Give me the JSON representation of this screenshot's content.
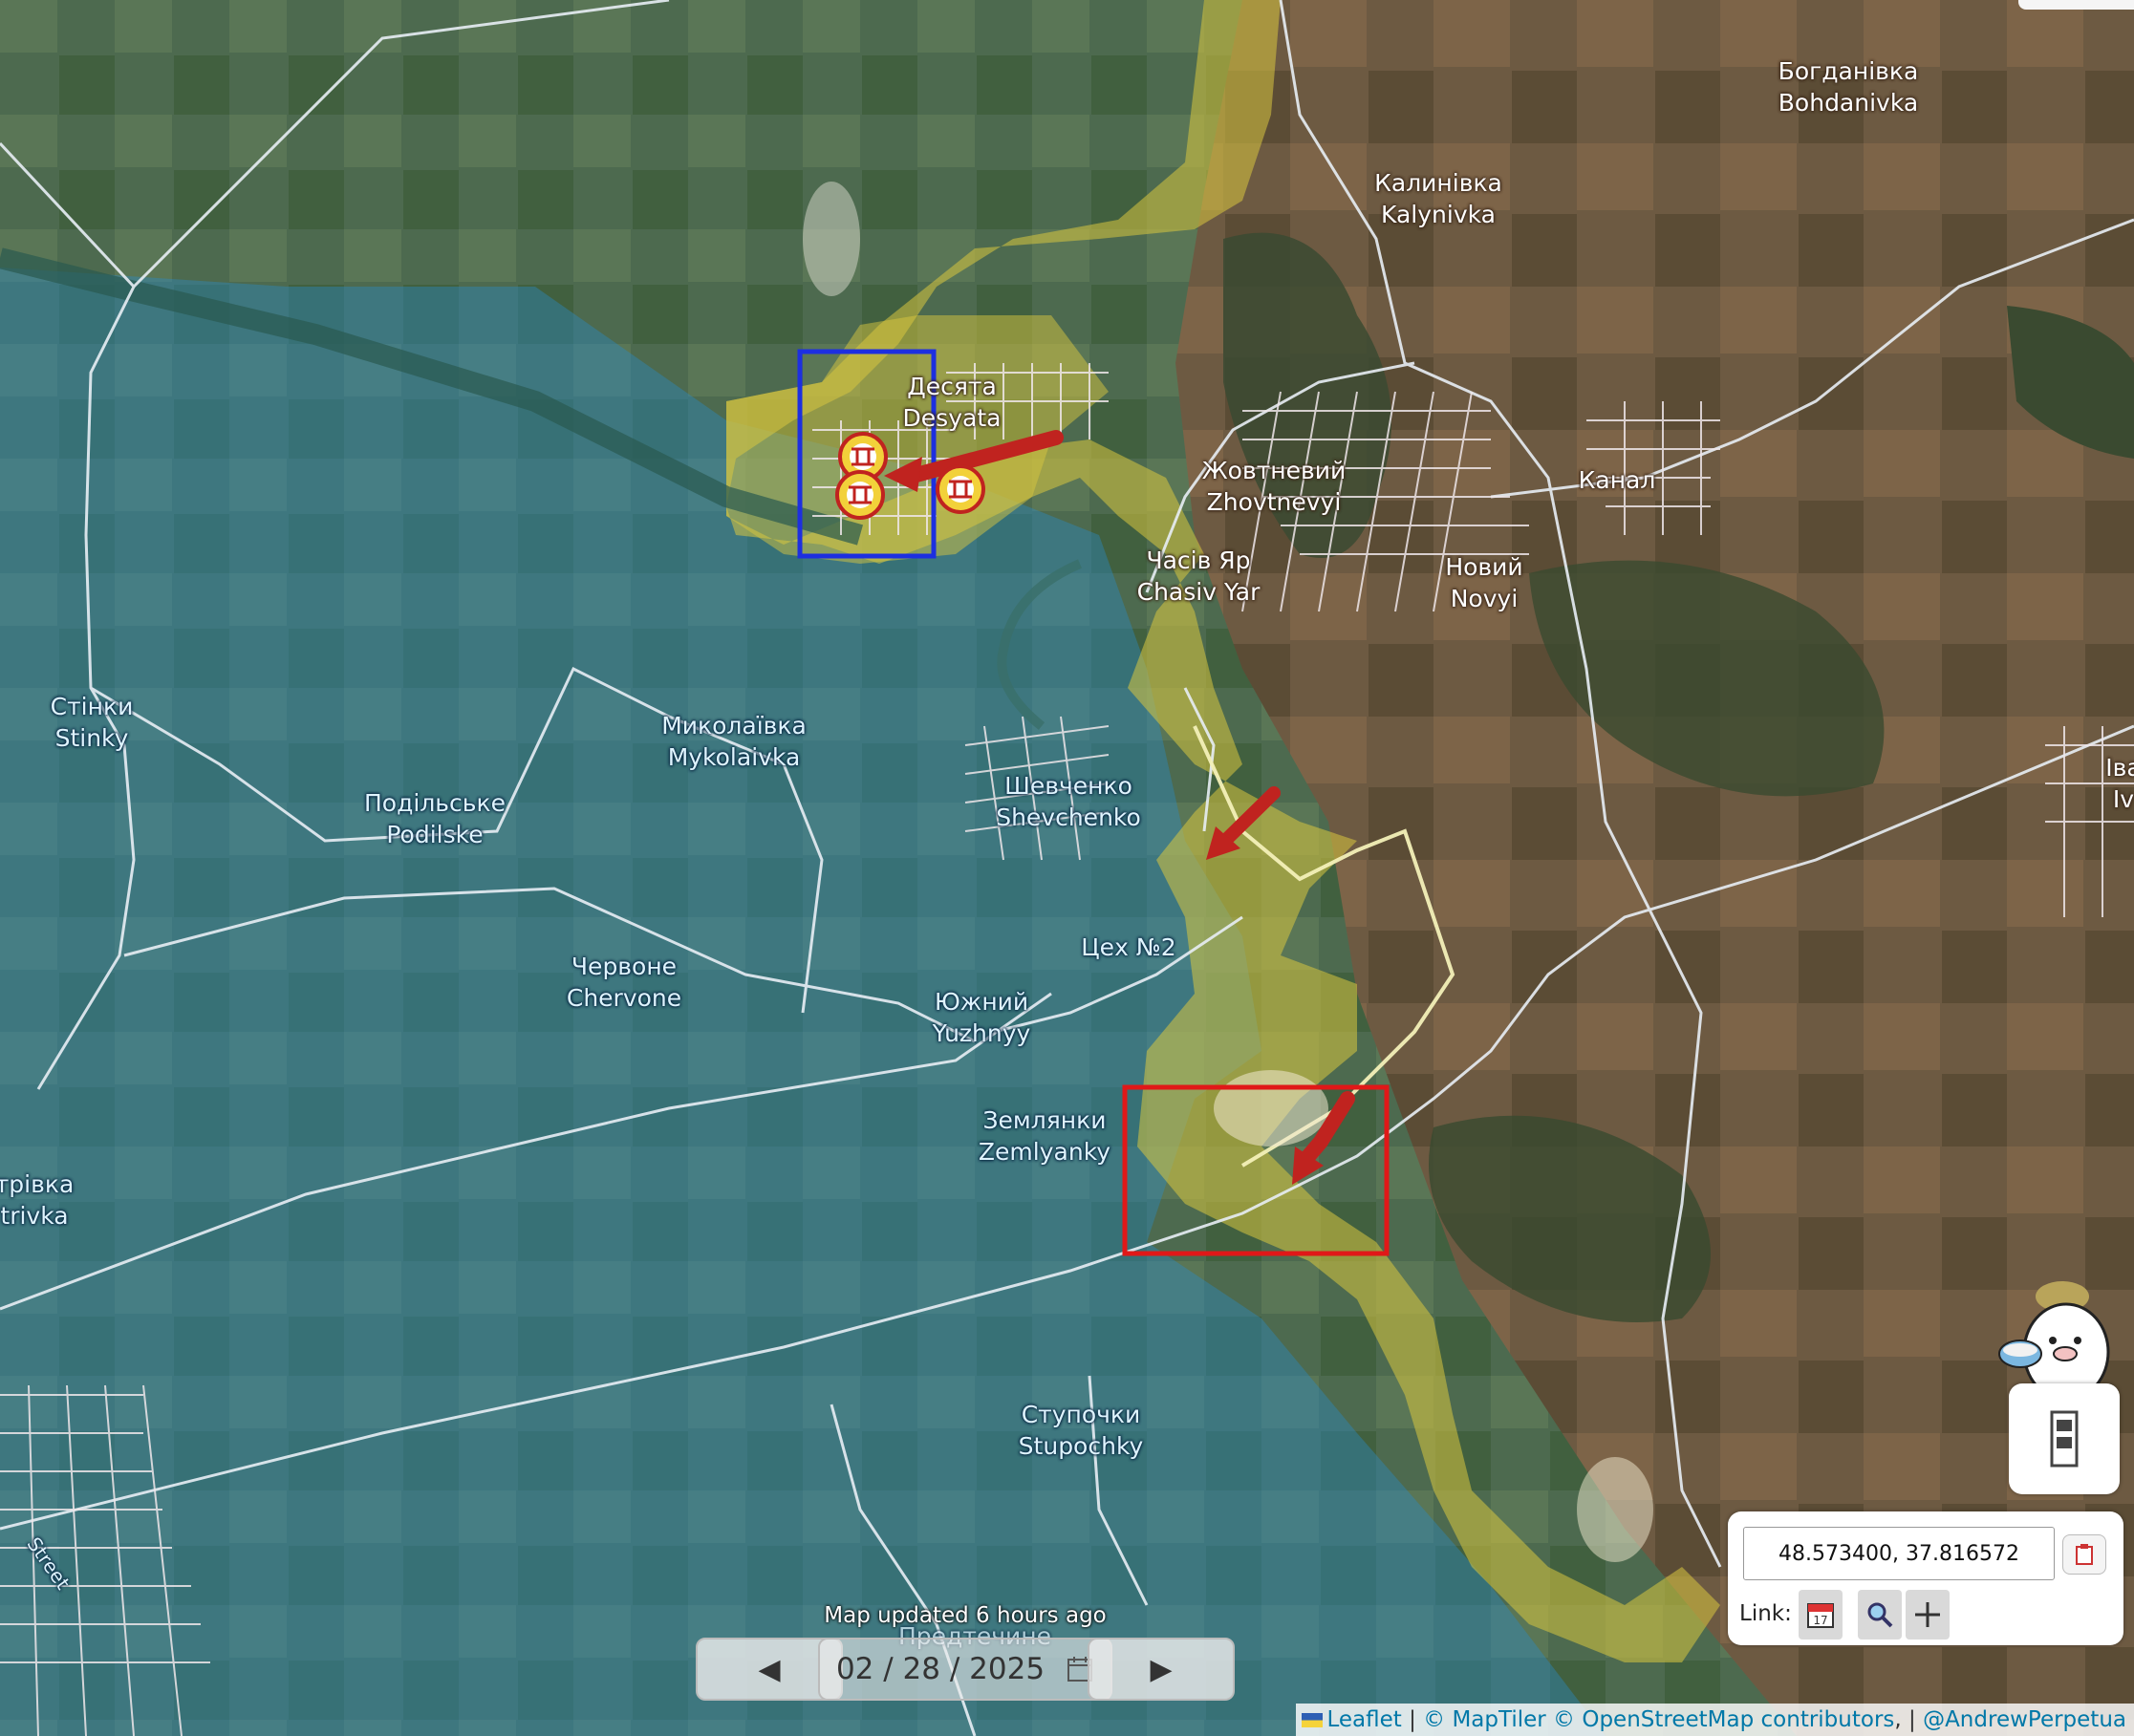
{
  "map": {
    "places": [
      {
        "id": "bohdanivka",
        "uk": "Богданівка",
        "en": "Bohdanivka",
        "style": "dark"
      },
      {
        "id": "kalynivka",
        "uk": "Калинівка",
        "en": "Kalynivka",
        "style": "dark"
      },
      {
        "id": "desyata",
        "uk": "Десята",
        "en": "Desyata",
        "style": "dark"
      },
      {
        "id": "zhovtnevyi",
        "uk": "Жовтневий",
        "en": "Zhovtnevyi",
        "style": "dark"
      },
      {
        "id": "kanal",
        "uk": "Канал",
        "en": "",
        "style": "dark"
      },
      {
        "id": "chasiv-yar",
        "uk": "Часів Яр",
        "en": "Chasiv Yar",
        "style": "dark"
      },
      {
        "id": "novyi",
        "uk": "Новий",
        "en": "Novyi",
        "style": "dark"
      },
      {
        "id": "stinky",
        "uk": "Стінки",
        "en": "Stinky",
        "style": "blue"
      },
      {
        "id": "mykolaivka",
        "uk": "Миколаївка",
        "en": "Mykolaivka",
        "style": "blue"
      },
      {
        "id": "shevchenko",
        "uk": "Шевченко",
        "en": "Shevchenko",
        "style": "blue"
      },
      {
        "id": "podilske",
        "uk": "Подільське",
        "en": "Podilske",
        "style": "blue"
      },
      {
        "id": "tsekh2",
        "uk": "Цех №2",
        "en": "",
        "style": "blue"
      },
      {
        "id": "chervone",
        "uk": "Червоне",
        "en": "Chervone",
        "style": "blue"
      },
      {
        "id": "yuzhnyi",
        "uk": "Южний",
        "en": "Yuzhnyy",
        "style": "blue"
      },
      {
        "id": "zemlyanky",
        "uk": "Землянки",
        "en": "Zemlyanky",
        "style": "blue"
      },
      {
        "id": "ostrivka",
        "uk": "трівка",
        "en": "trivka",
        "style": "blue"
      },
      {
        "id": "stupochky",
        "uk": "Ступочки",
        "en": "Stupochky",
        "style": "blue"
      },
      {
        "id": "iva",
        "uk": "Іва",
        "en": "Iv",
        "style": "dark"
      },
      {
        "id": "predtechyne",
        "uk": "Предтечине",
        "en": "",
        "style": "blue"
      },
      {
        "id": "street",
        "uk": "Street",
        "en": "",
        "style": "blue"
      }
    ],
    "colors": {
      "ukraine_control": "#2b8bc4",
      "contested": "#d8c640",
      "front_arrow": "#c0231f",
      "highlight_blue": "#1d2fe0",
      "highlight_red": "#e01818"
    },
    "icons": [
      "drone-icon",
      "drone-icon",
      "drone-icon"
    ]
  },
  "controls": {
    "updated": "Map updated 6 hours ago",
    "prev": "◀",
    "next": "▶",
    "date": "02 / 28 / 2025",
    "coords": "48.573400, 37.816572",
    "link_label": "Link:"
  },
  "attribution": {
    "leaflet": "Leaflet",
    "maptiler": "© MapTiler",
    "osm": "© OpenStreetMap contributors",
    "author": "@AndrewPerpetua"
  }
}
